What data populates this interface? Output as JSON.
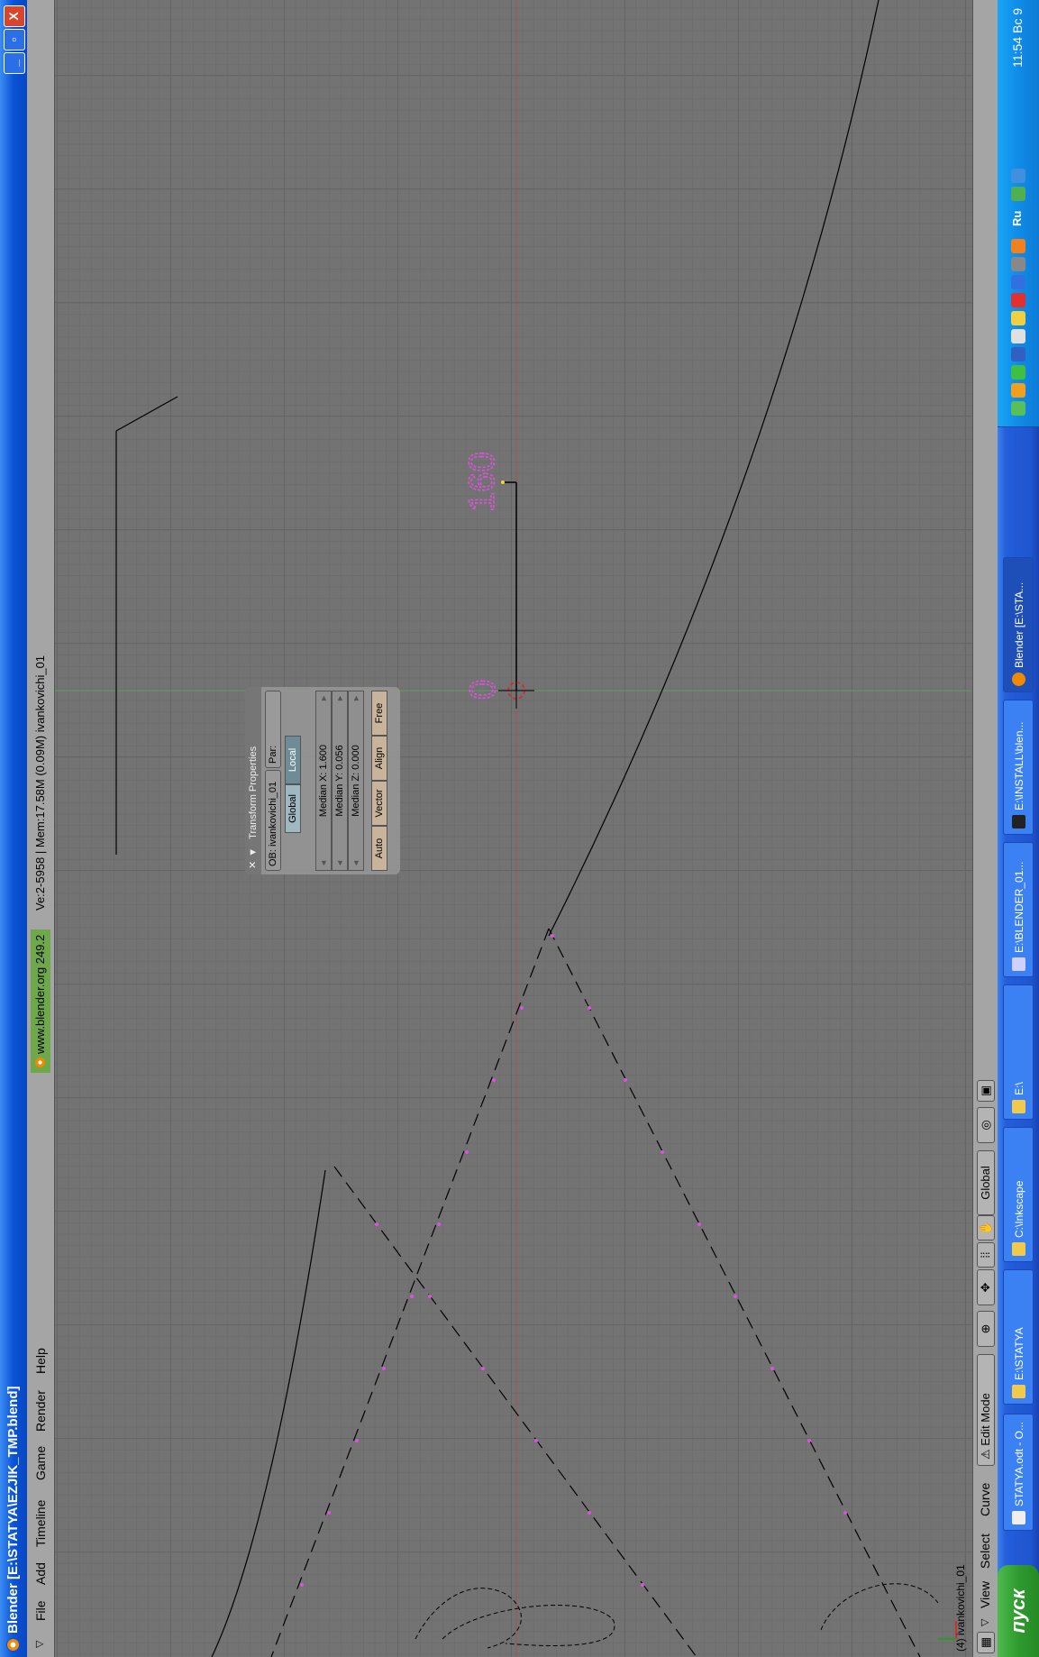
{
  "window": {
    "title": "Blender [E:\\STATYA\\EZJIK_TMP.blend]",
    "minimize_label": "_",
    "maximize_label": "▫",
    "close_label": "X"
  },
  "header": {
    "collapse_icon": "triangle-down-icon",
    "menus": [
      "File",
      "Add",
      "Timeline",
      "Game",
      "Render",
      "Help"
    ],
    "site": "www.blender.org 249.2",
    "stats": "Ve:2-5958 | Mem:17.58M (0.09M) ivankovichi_01"
  },
  "viewport": {
    "object_label": "(4) ivankovichi_01",
    "annotation_zero": "0",
    "annotation_160": "160",
    "axis_x_color": "#b04444",
    "axis_y_color": "#4f9a4f",
    "vertex_color": "#e050e0"
  },
  "transform_panel": {
    "title": "Transform Properties",
    "ob_field": "OB: ivankovichi_01",
    "par_field": "Par:",
    "global_label": "Global",
    "local_label": "Local",
    "median_x": "Median X: 1.600",
    "median_y": "Median Y: 0.056",
    "median_z": "Median Z: 0.000",
    "auto_label": "Auto",
    "vector_label": "Vector",
    "align_label": "Align",
    "free_label": "Free"
  },
  "footer": {
    "menus": [
      "View",
      "Select",
      "Curve"
    ],
    "mode": "Edit Mode",
    "orientation": "Global"
  },
  "taskbar": {
    "start_label": "пуск",
    "tasks": [
      "STATYA.odt - O...",
      "E:\\STATYA",
      "C:\\Inkscape",
      "E:\\",
      "E:\\BLENDER_01...",
      "E:\\INSTALL\\blen...",
      "Blender [E:\\STA..."
    ],
    "tray_lang": "Ru",
    "clock": "11:54 Вс 9"
  }
}
